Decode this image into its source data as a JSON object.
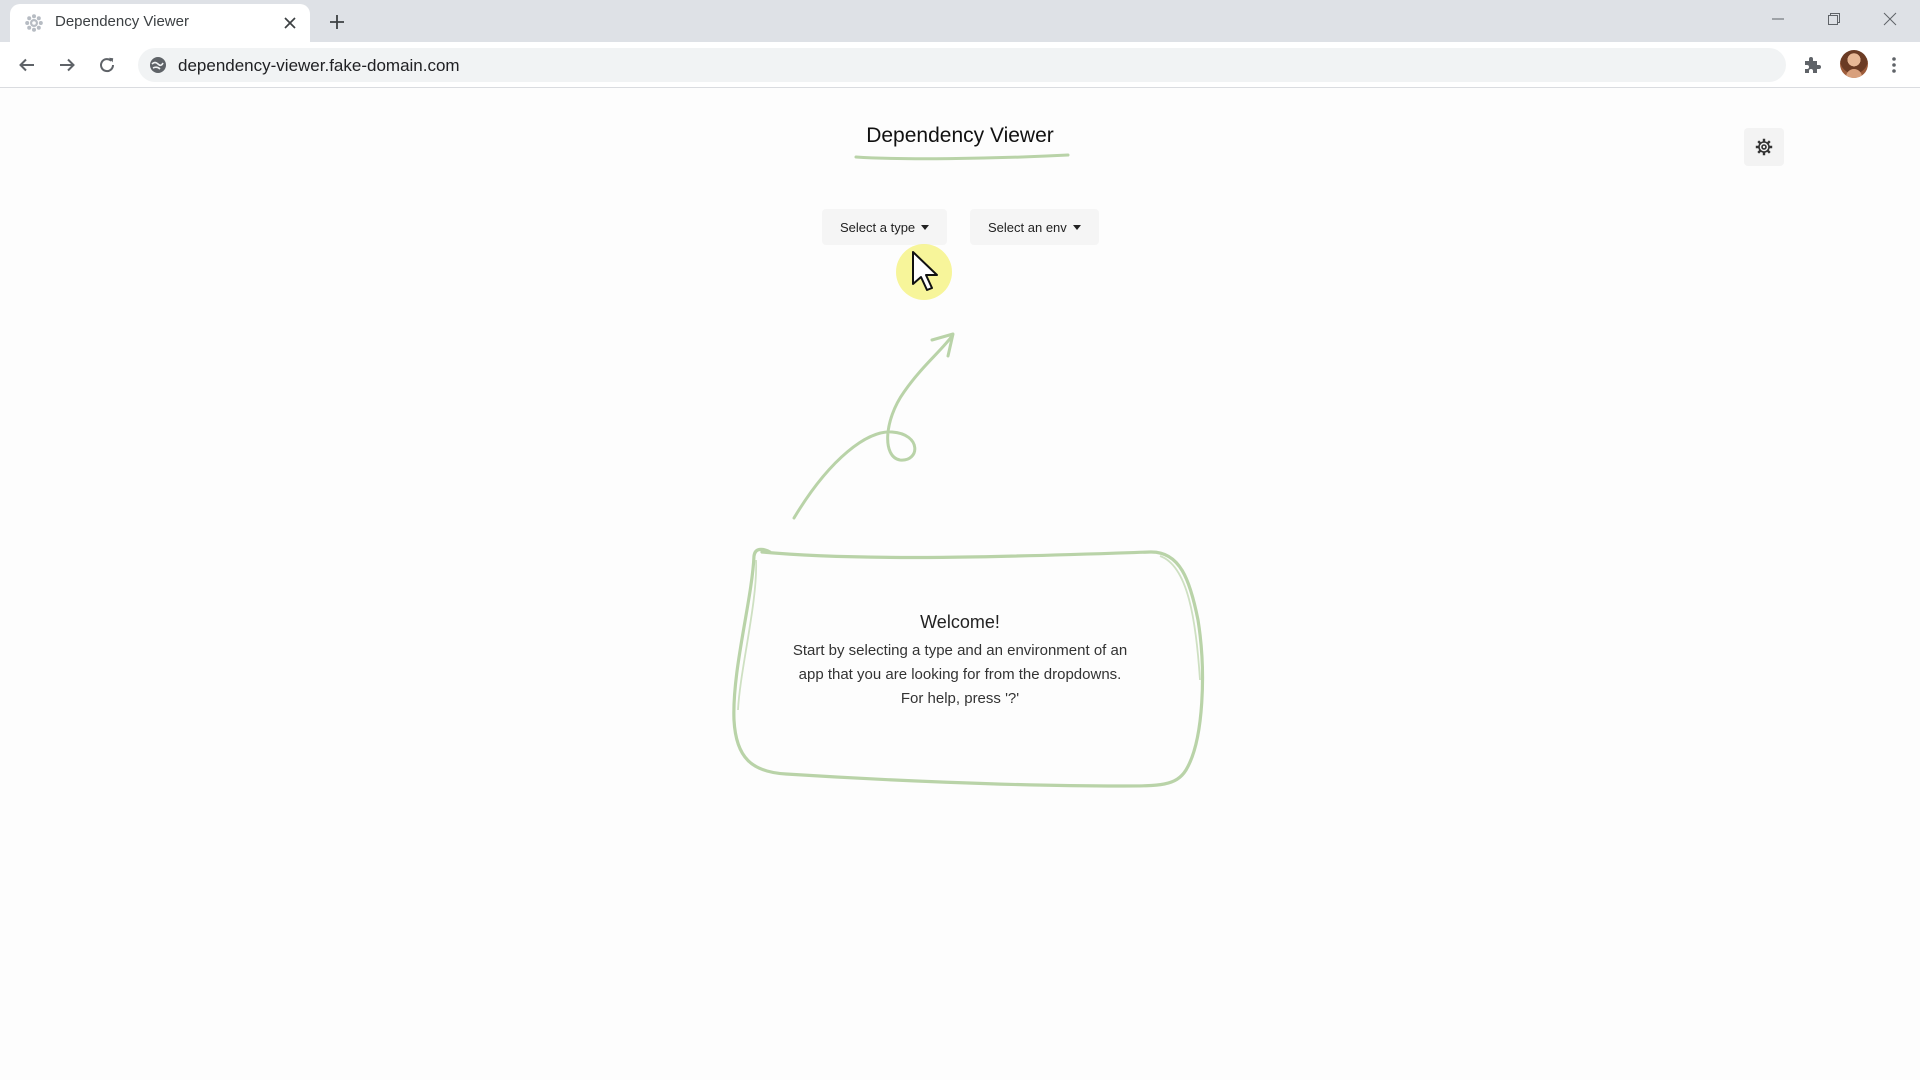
{
  "browser": {
    "tab_title": "Dependency Viewer",
    "url": "dependency-viewer.fake-domain.com",
    "icons": {
      "favicon": "gear-favicon-icon",
      "close_tab": "close-icon",
      "new_tab": "plus-icon",
      "back": "arrow-left-icon",
      "forward": "arrow-right-icon",
      "reload": "reload-icon",
      "site_info": "site-info-icon",
      "extensions": "puzzle-icon",
      "menu": "kebab-menu-icon",
      "minimize": "minimize-icon",
      "maximize": "restore-icon",
      "close_window": "close-icon"
    }
  },
  "app": {
    "title": "Dependency Viewer",
    "type_dropdown": "Select a type",
    "env_dropdown": "Select an env",
    "settings_icon": "gear-icon",
    "welcome": {
      "title": "Welcome!",
      "line1": "Start by selecting a type and an environment of an",
      "line2": "app that you are looking for from the dropdowns.",
      "line3": "For help, press '?'"
    },
    "colors": {
      "sketch": "#b9d3a8",
      "accent_underline": "#b9d3a8",
      "cursor_highlight": "#f4f278"
    }
  }
}
